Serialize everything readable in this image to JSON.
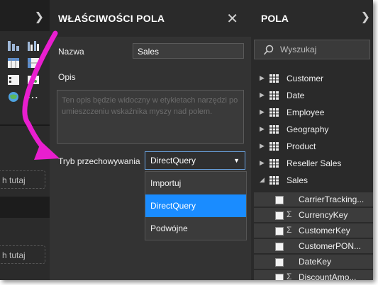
{
  "properties_panel": {
    "title": "WŁAŚCIWOŚCI POLA",
    "name_label": "Nazwa",
    "name_value": "Sales",
    "description_label": "Opis",
    "description_placeholder": "Ten opis będzie widoczny w etykietach narzędzi po umieszczeniu wskaźnika myszy nad polem.",
    "storage_label": "Tryb przechowywania",
    "storage_selected": "DirectQuery",
    "storage_options": [
      "Importuj",
      "DirectQuery",
      "Podwójne"
    ],
    "close_icon": "close-icon"
  },
  "left_panel": {
    "drop_zone_1": "h tutaj",
    "drop_zone_2": "h tutaj"
  },
  "fields_panel": {
    "title": "POLA",
    "search_placeholder": "Wyszukaj",
    "tables": [
      {
        "name": "Customer",
        "expanded": false
      },
      {
        "name": "Date",
        "expanded": false
      },
      {
        "name": "Employee",
        "expanded": false
      },
      {
        "name": "Geography",
        "expanded": false
      },
      {
        "name": "Product",
        "expanded": false
      },
      {
        "name": "Reseller Sales",
        "expanded": false
      },
      {
        "name": "Sales",
        "expanded": true
      }
    ],
    "fields": [
      {
        "name": "CarrierTracking...",
        "sigma": false
      },
      {
        "name": "CurrencyKey",
        "sigma": true
      },
      {
        "name": "CustomerKey",
        "sigma": true
      },
      {
        "name": "CustomerPON...",
        "sigma": false
      },
      {
        "name": "DateKey",
        "sigma": false
      },
      {
        "name": "DiscountAmo...",
        "sigma": true
      }
    ]
  },
  "colors": {
    "accent": "#1a8cff",
    "annotation_arrow": "#e91ecf"
  }
}
